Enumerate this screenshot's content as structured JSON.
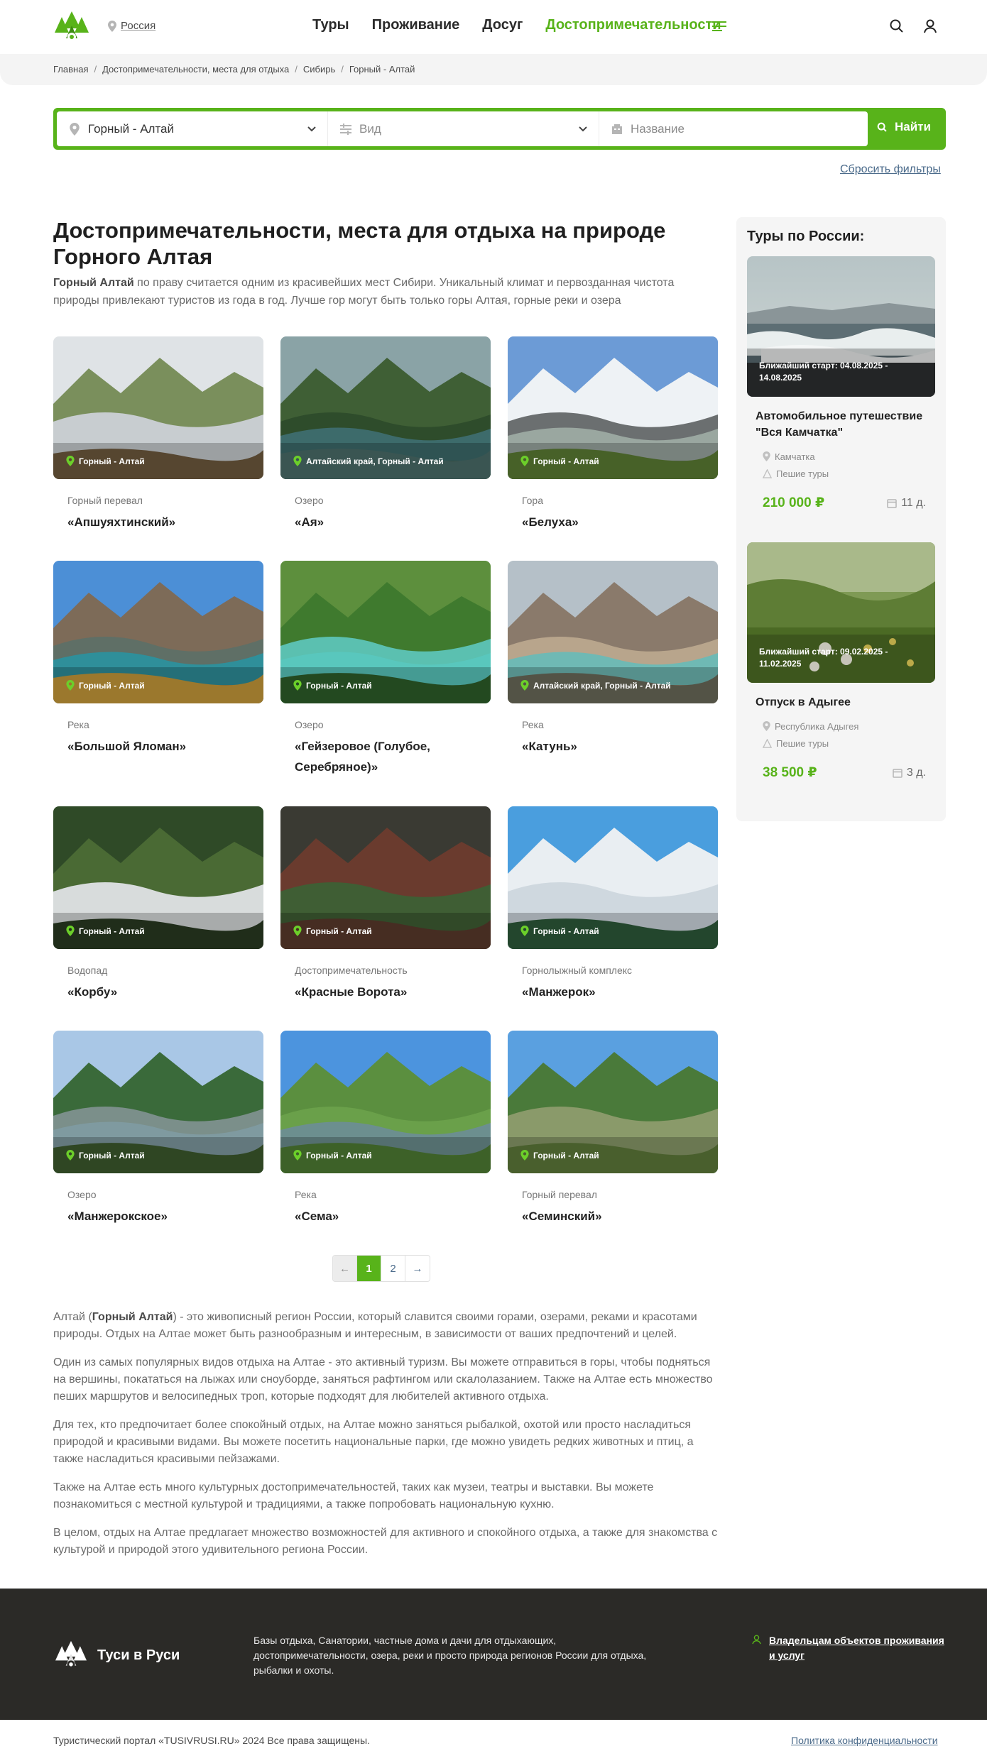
{
  "header": {
    "logo_name": "tree-logo-icon",
    "region": "Россия",
    "nav": [
      "Туры",
      "Проживание",
      "Досуг",
      "Достопримечательности"
    ],
    "accent": "#58b31a"
  },
  "breadcrumbs": [
    "Главная",
    "Достопримечательности, места для отдыха",
    "Сибирь",
    "Горный - Алтай"
  ],
  "filter": {
    "region_value": "Горный - Алтай",
    "kind_placeholder": "Вид",
    "name_placeholder": "Название",
    "find_label": "Найти",
    "reset_label": "Сбросить фильтры"
  },
  "page": {
    "title": "Достопримечательности, места для отдыха на природе Горного Алтая",
    "intro_bold": "Горный Алтай",
    "intro_rest": " по праву считается одним из красивейших мест Сибири. Уникальный климат и первозданная чистота природы привлекают туристов из года в год. Лучше гор могут быть только горы Алтая, горные реки и озера"
  },
  "places": [
    {
      "kind": "Горный перевал",
      "name": "«Апшуяхтинский»",
      "location": "Горный - Алтай"
    },
    {
      "kind": "Озеро",
      "name": "«Ая»",
      "location": "Алтайский край, Горный - Алтай"
    },
    {
      "kind": "Гора",
      "name": "«Белуха»",
      "location": "Горный - Алтай"
    },
    {
      "kind": "Река",
      "name": "«Большой Яломан»",
      "location": "Горный - Алтай"
    },
    {
      "kind": "Озеро",
      "name": "«Гейзеровое (Голубое, Серебряное)»",
      "location": "Горный - Алтай"
    },
    {
      "kind": "Река",
      "name": "«Катунь»",
      "location": "Алтайский край, Горный - Алтай"
    },
    {
      "kind": "Водопад",
      "name": "«Корбу»",
      "location": "Горный - Алтай"
    },
    {
      "kind": "Достопримечательность",
      "name": "«Красные Ворота»",
      "location": "Горный - Алтай"
    },
    {
      "kind": "Горнолыжный комплекс",
      "name": "«Манжерок»",
      "location": "Горный - Алтай"
    },
    {
      "kind": "Озеро",
      "name": "«Манжерокское»",
      "location": "Горный - Алтай"
    },
    {
      "kind": "Река",
      "name": "«Сема»",
      "location": "Горный - Алтай"
    },
    {
      "kind": "Горный перевал",
      "name": "«Семинский»",
      "location": "Горный - Алтай"
    }
  ],
  "pagination": {
    "prev": "←",
    "pages": [
      "1",
      "2"
    ],
    "next": "→",
    "current": "1"
  },
  "article": {
    "p1_pre": "Алтай (",
    "p1_bold": "Горный Алтай",
    "p1_post": ") - это живописный регион России, который славится своими горами, озерами, реками и красотами природы. Отдых на Алтае может быть разнообразным и интересным, в зависимости от ваших предпочтений и целей.",
    "p2": "Один из самых популярных видов отдыха на Алтае - это активный туризм. Вы можете отправиться в горы, чтобы подняться на вершины, покататься на лыжах или сноуборде, заняться рафтингом или скалолазанием. Также на Алтае есть множество пеших маршрутов и велосипедных троп, которые подходят для любителей активного отдыха.",
    "p3": "Для тех, кто предпочитает более спокойный отдых, на Алтае можно заняться рыбалкой, охотой или просто насладиться природой и красивыми видами. Вы можете посетить национальные парки, где можно увидеть редких животных и птиц, а также насладиться красивыми пейзажами.",
    "p4": "Также на Алтае есть много культурных достопримечательностей, таких как музеи, театры и выставки. Вы можете познакомиться с местной культурой и традициями, а также попробовать национальную кухню.",
    "p5": "В целом, отдых на Алтае предлагает множество возможностей для активного и спокойного отдыха, а также для знакомства с культурой и природой этого удивительного региона России."
  },
  "sidebar": {
    "title": "Туры по России:",
    "tours": [
      {
        "start": "Ближайший старт: 04.08.2025 - 14.08.2025",
        "name": "Автомобильное путешествие \"Вся Камчатка\"",
        "region": "Камчатка",
        "type": "Пешие туры",
        "price": "210 000 ₽",
        "days": "11 д."
      },
      {
        "start": "Ближайший старт: 09.02.2025 - 11.02.2025",
        "name": "Отпуск в Адыгее",
        "region": "Республика Адыгея",
        "type": "Пешие туры",
        "price": "38 500 ₽",
        "days": "3 д."
      }
    ]
  },
  "footer": {
    "brand": "Туси в Руси",
    "description": "Базы отдыха, Санатории, частные дома и дачи для отдыхающих, достопримечательности, озера, реки и просто природа регионов России для отдыха, рыбалки и охоты.",
    "owners_link": "Владельцам объектов проживания и услуг",
    "copyright": "Туристический портал «TUSIVRUSI.RU» 2024 Все права защищены.",
    "policy": "Политика конфиденциальности"
  }
}
